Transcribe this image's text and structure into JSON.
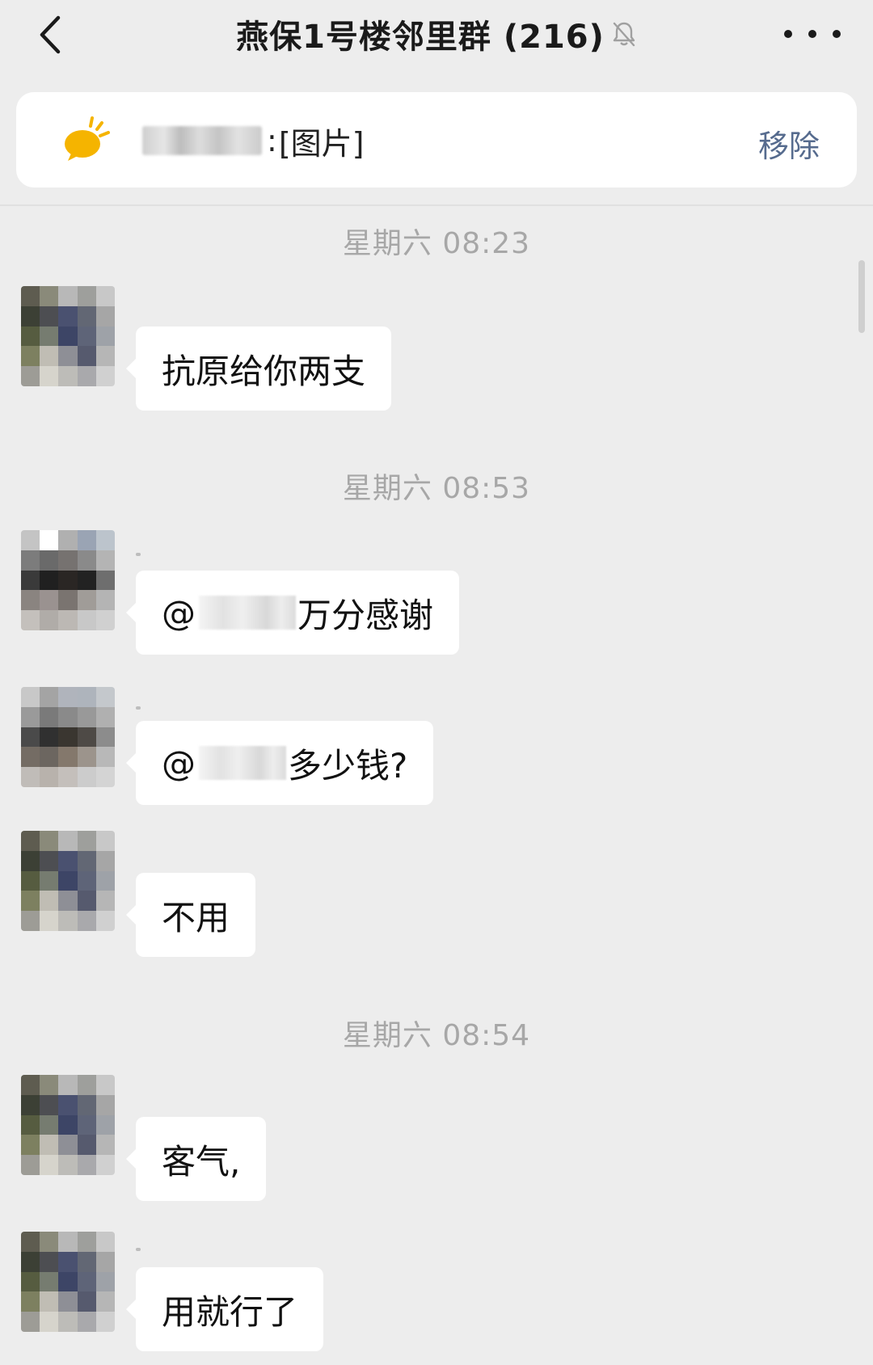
{
  "header": {
    "title": "燕保1号楼邻里群 (216)",
    "back_icon": "chevron-left-icon",
    "mute_icon": "bell-off-icon",
    "more_icon": "ellipsis-icon"
  },
  "pinned": {
    "icon": "megaphone-sun-icon",
    "separator": ":",
    "content": "[图片]",
    "remove_label": "移除"
  },
  "timestamps": [
    "星期六 08:23",
    "星期六 08:53",
    "星期六 08:54"
  ],
  "messages": [
    {
      "text": "抗原给你两支"
    },
    {
      "prefix": "@",
      "text": "万分感谢"
    },
    {
      "prefix": "@",
      "text": "多少钱?"
    },
    {
      "text": "不用"
    },
    {
      "text": "客气,"
    },
    {
      "text": "用就行了"
    }
  ],
  "colors": {
    "background": "#ededed",
    "bubble": "#ffffff",
    "timestamp": "#a7a7a7",
    "remove_link": "#566b8e",
    "pin_icon": "#f5b400"
  }
}
